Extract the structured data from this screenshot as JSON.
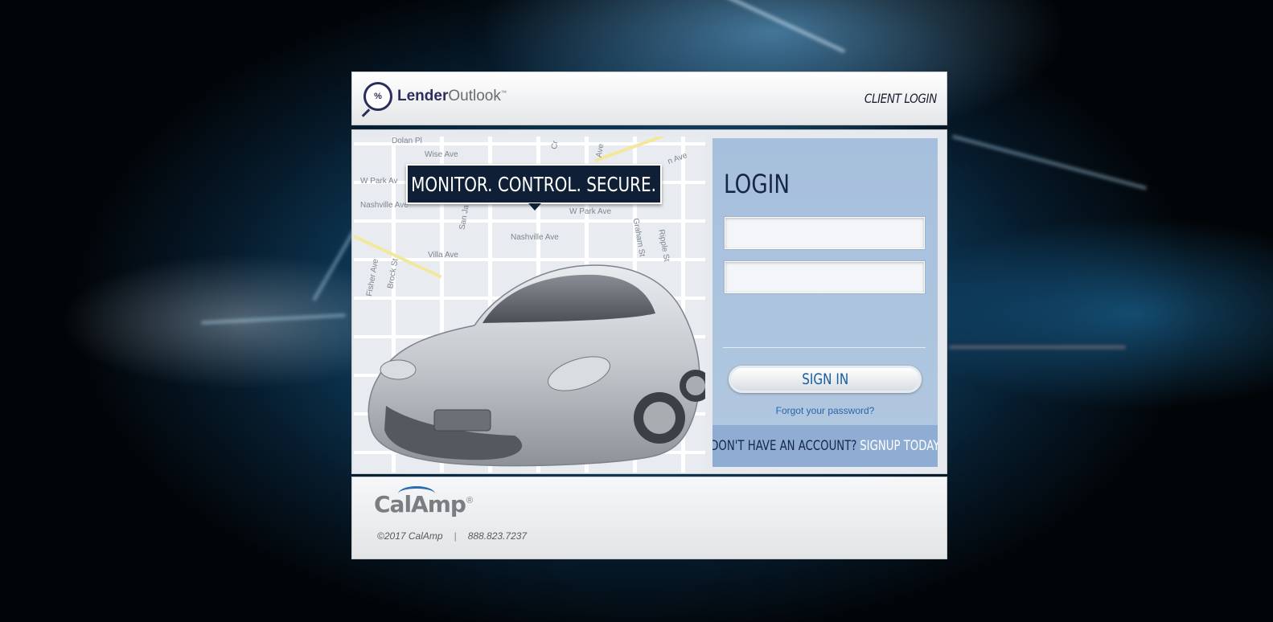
{
  "header": {
    "logo_bold": "Lender",
    "logo_light": "Outlook",
    "logo_tm": "™",
    "client_login": "CLIENT LOGIN"
  },
  "hero": {
    "tagline": "MONITOR. CONTROL. SECURE.",
    "streets": [
      "Dolan Pl",
      "Wise Ave",
      "W Park Av",
      "Nashville Ave",
      "W Park Ave",
      "Nashville Ave",
      "Villa Ave",
      "Graham St",
      "Ripple St",
      "Brock St",
      "Fisher Ave",
      "San Ja",
      "Ave",
      "Cr",
      "n Ave"
    ]
  },
  "login": {
    "title": "LOGIN",
    "username_value": "",
    "password_value": "",
    "sign_in_label": "SIGN IN",
    "forgot_label": "Forgot your password?",
    "signup_question": "DON'T HAVE AN ACCOUNT?",
    "signup_link": "SIGNUP TODAY"
  },
  "footer": {
    "brand": "CalAmp",
    "registered": "®",
    "copyright": "©2017 CalAmp",
    "separator": "|",
    "phone": "888.823.7237"
  },
  "colors": {
    "login_panel": "#a6bfdc",
    "signup_bar": "#8fadd2",
    "tagline_bg": "#0f1f35",
    "link": "#2766a8"
  }
}
